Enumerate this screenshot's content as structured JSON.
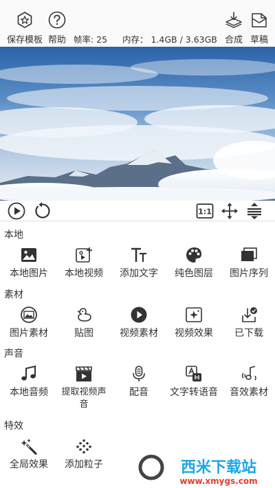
{
  "topbar": {
    "save_template": "保存模板",
    "help": "帮助",
    "framerate": "帧率: 25",
    "memory": "内存： 1.4GB / 3.63GB",
    "compose": "合成",
    "draft": "草稿"
  },
  "sections": {
    "local": {
      "title": "本地",
      "items": [
        "本地图片",
        "本地视频",
        "添加文字",
        "纯色图层",
        "图片序列"
      ]
    },
    "material": {
      "title": "素材",
      "items": [
        "图片素材",
        "贴图",
        "视频素材",
        "视频效果",
        "已下载"
      ]
    },
    "audio": {
      "title": "声音",
      "items": [
        "本地音频",
        "提取视频声音",
        "配音",
        "文字转语音",
        "音效素材"
      ]
    },
    "effects": {
      "title": "特效",
      "items": [
        "全局效果",
        "添加粒子"
      ]
    }
  },
  "controls": {
    "ratio": "1:1"
  },
  "watermark": {
    "text": "西米下载站",
    "url": "www.xmygs.com"
  },
  "icons": [
    "template-star-icon",
    "help-question-icon",
    "compose-download-icon",
    "draft-icon",
    "play-icon",
    "replay-icon",
    "ratio-icon",
    "move-icon",
    "align-icon"
  ],
  "colors": {
    "accent": "#333333",
    "watermark_blue": "#1aa7e8",
    "watermark_red": "#e63a2e"
  }
}
